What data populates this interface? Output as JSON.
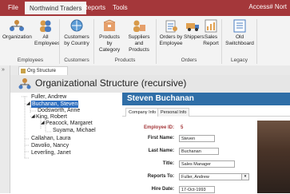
{
  "window": {
    "title": "Access# Nort"
  },
  "menu_tabs": [
    {
      "label": "File"
    },
    {
      "label": "Northwind Traders"
    },
    {
      "label": "Reports"
    },
    {
      "label": "Tools"
    }
  ],
  "ribbon": {
    "buttons": [
      {
        "label": "Organization"
      },
      {
        "label": "All Employees"
      },
      {
        "label": "Customers by Country"
      },
      {
        "label": "Products by Category"
      },
      {
        "label": "Suppliers and Products"
      },
      {
        "label": "Orders by Employee"
      },
      {
        "label": "Shippers"
      },
      {
        "label": "Sales Report"
      },
      {
        "label": "Old Switchboard"
      }
    ],
    "groups": [
      {
        "label": "Employees"
      },
      {
        "label": "Customers"
      },
      {
        "label": "Products"
      },
      {
        "label": "Orders"
      },
      {
        "label": "Legacy"
      }
    ]
  },
  "document_tab": {
    "label": "Org Structure"
  },
  "form": {
    "title": "Organizational Structure (recursive)",
    "tree": [
      {
        "label": "Fuller, Andrew"
      },
      {
        "label": "Buchanan, Steven"
      },
      {
        "label": "Dodsworth, Anne"
      },
      {
        "label": "King, Robert"
      },
      {
        "label": "Peacock, Margaret"
      },
      {
        "label": "Suyama, Michael"
      },
      {
        "label": "Callahan, Laura"
      },
      {
        "label": "Davolio, Nancy"
      },
      {
        "label": "Leverling, Janet"
      }
    ],
    "employee_name": "Steven Buchanan",
    "detail_tabs": [
      {
        "label": "Company Info"
      },
      {
        "label": "Personal Info"
      }
    ],
    "fields": {
      "employee_id_label": "Employee ID:",
      "employee_id_value": "5",
      "first_name_label": "First Name:",
      "first_name_value": "Steven",
      "last_name_label": "Last Name:",
      "last_name_value": "Buchanan",
      "title_label": "Title:",
      "title_value": "Sales Manager",
      "reports_to_label": "Reports To:",
      "reports_to_value": "Fuller, Andrew",
      "hire_date_label": "Hire Date:",
      "hire_date_value": "17-Oct-1993"
    }
  },
  "colors": {
    "accent": "#a4373a",
    "header_blue": "#2f6ea7",
    "selection": "#2f6fbf"
  }
}
